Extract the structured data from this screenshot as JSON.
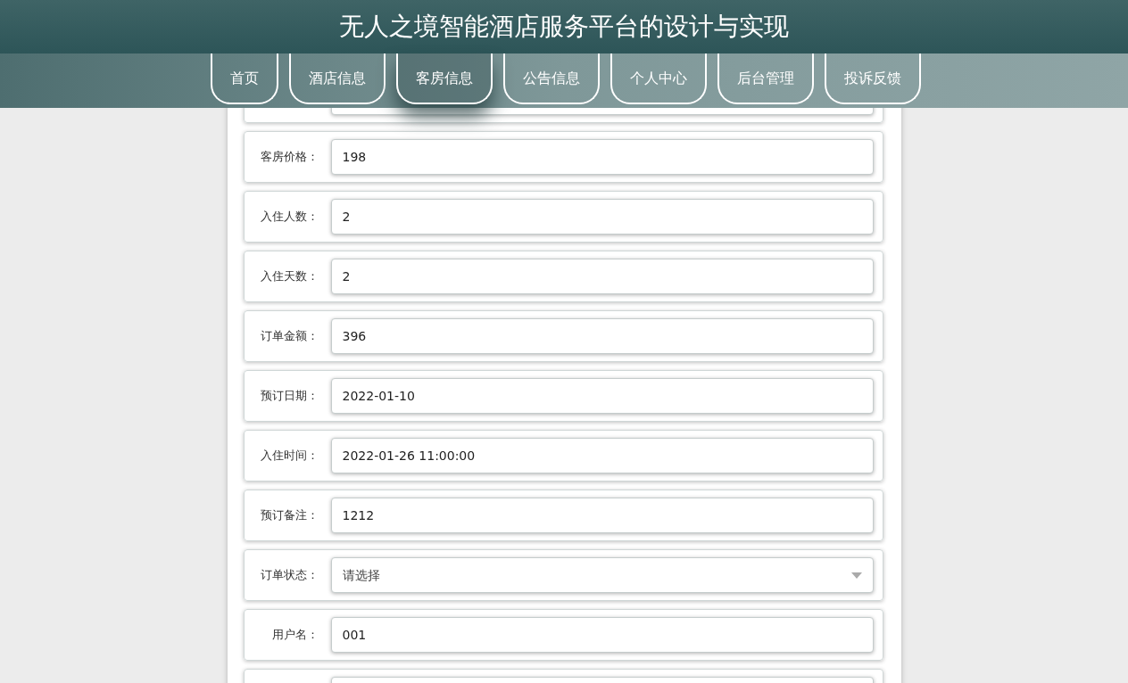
{
  "header": {
    "title": "无人之境智能酒店服务平台的设计与实现"
  },
  "nav": [
    {
      "label": "首页",
      "selected": false
    },
    {
      "label": "酒店信息",
      "selected": false
    },
    {
      "label": "客房信息",
      "selected": true
    },
    {
      "label": "公告信息",
      "selected": false
    },
    {
      "label": "个人中心",
      "selected": false
    },
    {
      "label": "后台管理",
      "selected": false
    },
    {
      "label": "投诉反馈",
      "selected": false
    }
  ],
  "form": {
    "fields": [
      {
        "kind": "text"
      },
      {
        "kind": "text",
        "label": "客房价格：",
        "value": "198"
      },
      {
        "kind": "text",
        "label": "入住人数：",
        "value": "2"
      },
      {
        "kind": "text",
        "label": "入住天数：",
        "value": "2"
      },
      {
        "kind": "text",
        "label": "订单金额：",
        "value": "396"
      },
      {
        "kind": "text",
        "label": "预订日期：",
        "value": "2022-01-10"
      },
      {
        "kind": "text",
        "label": "入住时间：",
        "value": "2022-01-26 11:00:00"
      },
      {
        "kind": "text",
        "label": "预订备注：",
        "value": "1212"
      },
      {
        "kind": "select",
        "label": "订单状态：",
        "placeholder": "请选择"
      },
      {
        "kind": "text",
        "label": "用户名：",
        "value": "001"
      },
      {
        "kind": "text"
      }
    ]
  }
}
